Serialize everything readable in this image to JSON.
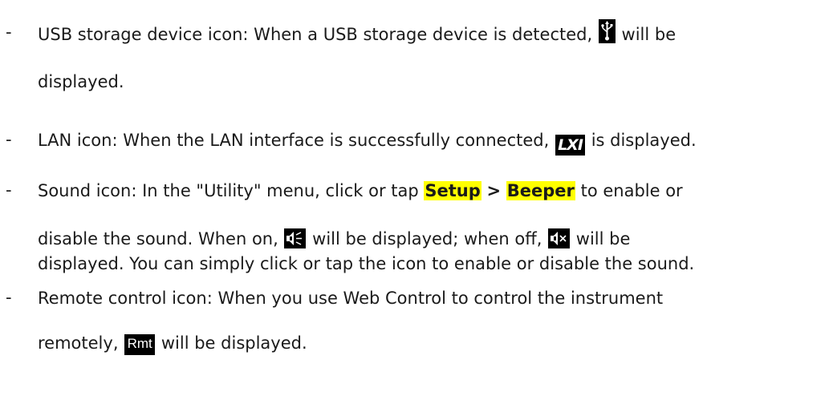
{
  "bullets": [
    {
      "marker": "-",
      "line1_before": "USB storage device icon: When a USB storage device is detected,",
      "icon": "usb-storage-icon",
      "line1_after": "will be",
      "line2": "displayed."
    },
    {
      "marker": "-",
      "line1_before": "LAN icon: When the LAN interface is successfully connected,",
      "icon": "lxi-lan-icon",
      "icon_text": "LXI",
      "line1_after": "is displayed."
    },
    {
      "marker": "-",
      "line1_before": "Sound icon: In the \"Utility\" menu, click or tap",
      "menu_setup": "Setup",
      "separator": ">",
      "menu_beeper": "Beeper",
      "line1_after": "to enable or",
      "line2_before": "disable the sound. When on,",
      "icon_on": "speaker-on-icon",
      "line2_middle": "will be displayed; when off,",
      "icon_off": "speaker-off-icon",
      "line2_after": "will be",
      "line3": "displayed. You can simply click or tap the icon to enable or disable the sound."
    },
    {
      "marker": "-",
      "line1": "Remote control icon: When you use Web Control to control the instrument",
      "line2_before": "remotely,",
      "icon": "remote-control-icon",
      "icon_text": "Rmt",
      "line2_after": "will be displayed."
    }
  ],
  "colors": {
    "highlight": "#ffff00",
    "icon_background": "#000000",
    "text": "#1a1a1a"
  }
}
